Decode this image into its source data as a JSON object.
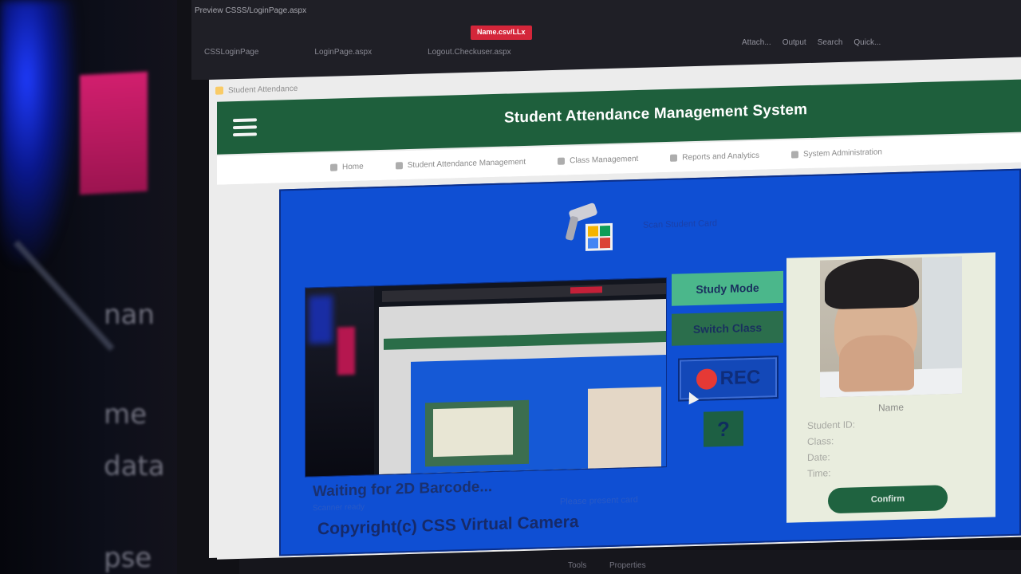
{
  "ide": {
    "title": "Preview  CSSS/LoginPage.aspx",
    "tabs": [
      "",
      "",
      "Name.csv/LLx"
    ],
    "subtabs": [
      "CSSLoginPage",
      "LoginPage.aspx",
      "Logout.Checkuser.aspx"
    ],
    "toolbar": [
      "Attach...",
      "Output",
      "Search",
      "Quick..."
    ],
    "bottom_status": [
      "Tools",
      "Properties"
    ]
  },
  "browser": {
    "tab_title": "Student Attendance"
  },
  "app": {
    "title": "Student Attendance Management System",
    "nav": [
      "Home",
      "Student Attendance Management",
      "Class Management",
      "Reports and Analytics",
      "System Administration"
    ]
  },
  "scanner": {
    "caption": "Scan Student Card"
  },
  "buttons": {
    "study_mode": "Study Mode",
    "switch_class": "Switch Class",
    "rec": "REC",
    "help": "?",
    "confirm": "Confirm"
  },
  "student": {
    "name": "Name",
    "lines": [
      "Student ID:",
      "Class:",
      "Date:",
      "Time:"
    ]
  },
  "status": {
    "waiting": "Waiting for 2D Barcode...",
    "sub_left": "Scanner ready",
    "sub_right": "Please present card",
    "copyright": "Copyright(c) CSS Virtual Camera"
  },
  "colors": {
    "header_green": "#1e5f3c",
    "panel_blue": "#0f4fd3",
    "rec_red": "#e53935",
    "study_green": "#4bb78b"
  },
  "icons": [
    "hamburger-icon",
    "barcode-scanner-icon",
    "qr-code-icon",
    "record-dot-icon",
    "cursor-icon"
  ]
}
